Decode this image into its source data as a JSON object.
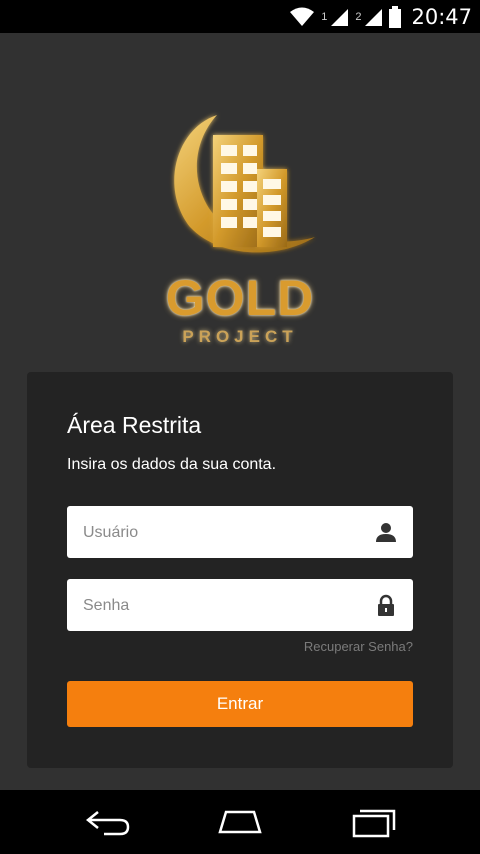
{
  "status_bar": {
    "sim1": "1",
    "sim2": "2",
    "time": "20:47"
  },
  "logo": {
    "word1": "GOLD",
    "word2": "PROJECT",
    "gold_color": "#d99b2e"
  },
  "login": {
    "title": "Área Restrita",
    "subtitle": "Insira os dados da sua conta.",
    "username_placeholder": "Usuário",
    "password_placeholder": "Senha",
    "recover_label": "Recuperar Senha?",
    "submit_label": "Entrar",
    "accent_color": "#f57f0e"
  },
  "icons": {
    "username": "user-icon",
    "password": "lock-icon",
    "back": "back-icon",
    "home": "home-icon",
    "recents": "recents-icon"
  }
}
